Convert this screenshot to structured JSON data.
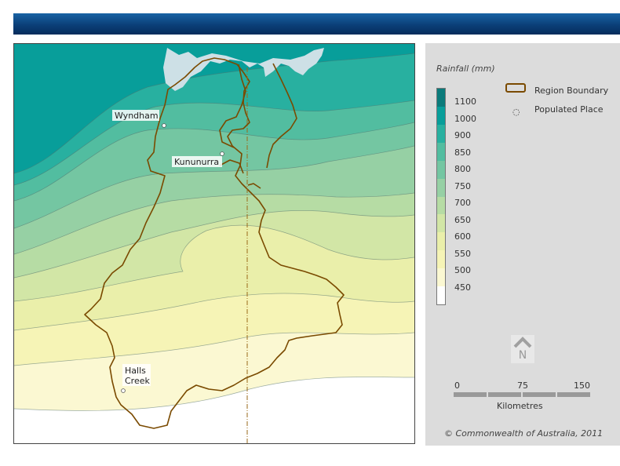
{
  "legend": {
    "title": "Rainfall (mm)",
    "classes": [
      {
        "label": "1100",
        "color": "#0b7b7b"
      },
      {
        "label": "1000",
        "color": "#089e9a"
      },
      {
        "label": "900",
        "color": "#28b0a0"
      },
      {
        "label": "850",
        "color": "#52bda0"
      },
      {
        "label": "800",
        "color": "#74c6a2"
      },
      {
        "label": "750",
        "color": "#96d0a4"
      },
      {
        "label": "700",
        "color": "#b6dca4"
      },
      {
        "label": "650",
        "color": "#d2e6a6"
      },
      {
        "label": "600",
        "color": "#eaefaa"
      },
      {
        "label": "550",
        "color": "#f6f4b6"
      },
      {
        "label": "500",
        "color": "#fbf8d2"
      },
      {
        "label": "450",
        "color": "#ffffff"
      }
    ],
    "region_boundary_label": "Region Boundary",
    "populated_place_label": "Populated Place",
    "populated_place_icon": "populated-place-icon",
    "boundary_color": "#7a4a00"
  },
  "north_arrow": {
    "letter": "N",
    "icon": "north-arrow-icon"
  },
  "scale": {
    "ticks": [
      "0",
      "75",
      "150"
    ],
    "unit": "Kilometres"
  },
  "copyright": "© Commonwealth of Australia, 2011",
  "places": [
    {
      "name": "Wyndham",
      "lines": [
        "Wyndham"
      ]
    },
    {
      "name": "Kununurra",
      "lines": [
        "Kununurra"
      ]
    },
    {
      "name": "Halls Creek",
      "lines": [
        "Halls",
        "Creek"
      ]
    }
  ],
  "colors": {
    "banner": "#0b3f78",
    "sea": "#cde0e6"
  }
}
